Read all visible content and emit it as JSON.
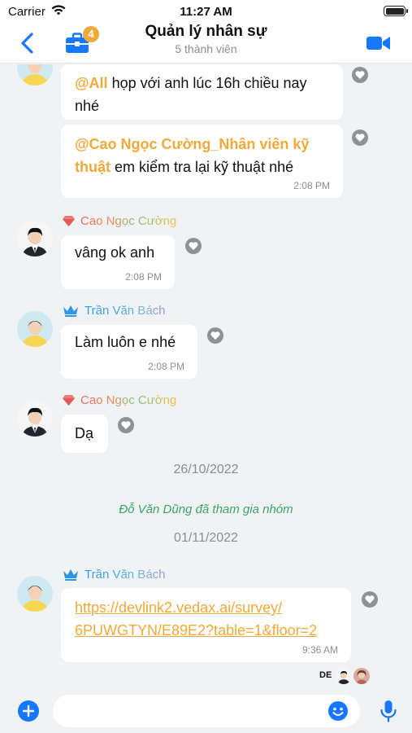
{
  "status_bar": {
    "carrier": "Carrier",
    "time": "11:27 AM"
  },
  "header": {
    "title": "Quản lý nhân sự",
    "subtitle": "5 thành viên",
    "briefcase_badge": "4",
    "icons": [
      "chevron-left-icon",
      "briefcase-icon",
      "video-camera-icon"
    ],
    "accent_color": "#1677ff",
    "badge_color": "#f0a93b"
  },
  "messages": [
    {
      "mention": "@All",
      "text": " họp với anh lúc 16h chiều nay nhé"
    },
    {
      "mention": "@Cao Ngọc Cường_Nhân viên kỹ thuật",
      "text": " em kiểm tra lại kỹ thuật nhé",
      "time": "2:08 PM"
    },
    {
      "sender": "Cao Ngọc Cường",
      "text": "vâng ok anh",
      "time": "2:08 PM"
    },
    {
      "sender": "Trần Văn Bách",
      "text": "Làm luôn e nhé",
      "time": "2:08 PM"
    },
    {
      "sender": "Cao Ngọc Cường",
      "text": "Dạ"
    },
    {
      "sender": "Trần Văn Bách",
      "link_line1": "https://devlink2.vedax.ai/survey/",
      "link_line2": "6PUWGTYN/E89E2?table=1&floor=2",
      "time": "9:36 AM"
    }
  ],
  "dates": [
    "26/10/2022",
    "01/11/2022"
  ],
  "system_message": "Đỗ Văn Dũng đã tham gia nhóm",
  "seen_by": {
    "initials": "DE"
  },
  "composer": {
    "placeholder": "",
    "value": ""
  },
  "colors": {
    "mention": "#f0a93b",
    "system": "#3aa46d",
    "background": "#f1f2f4"
  }
}
